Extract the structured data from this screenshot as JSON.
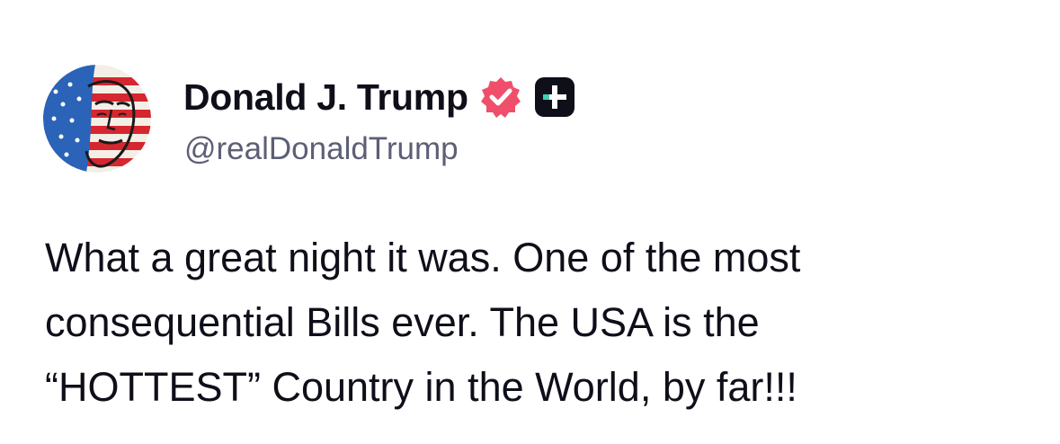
{
  "author": {
    "display_name": "Donald J. Trump",
    "handle": "@realDonaldTrump",
    "verified_icon": "verified-badge-icon",
    "subscription_icon": "truth-plus-icon"
  },
  "post": {
    "lines": [
      "What a great night it was. One of the most",
      "consequential Bills ever. The USA is the",
      "“HOTTEST” Country in the World, by far!!!"
    ]
  },
  "colors": {
    "text": "#0f0f1a",
    "handle": "#5c5f75",
    "verified": "#ef4f6a",
    "plus_bg": "#0f0f1a",
    "plus_accent": "#3fd1b0",
    "background": "#ffffff"
  }
}
